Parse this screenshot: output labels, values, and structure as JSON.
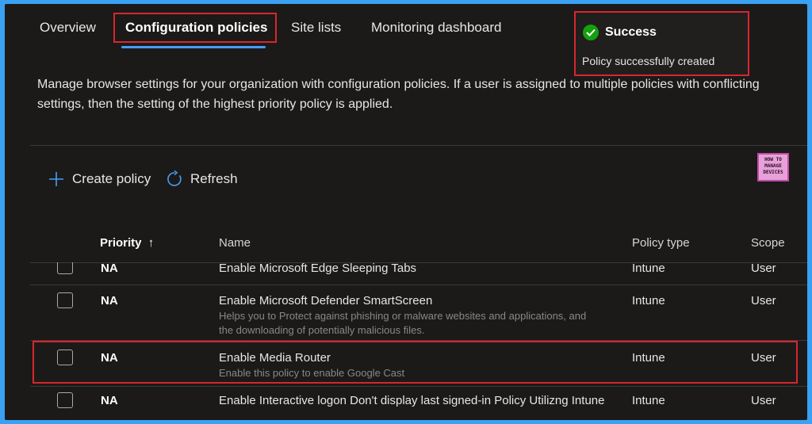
{
  "tabs": [
    {
      "label": "Overview"
    },
    {
      "label": "Configuration policies"
    },
    {
      "label": "Site lists"
    },
    {
      "label": "Monitoring dashboard"
    }
  ],
  "toast": {
    "title": "Success",
    "message": "Policy successfully created",
    "status_color": "#13a10e"
  },
  "description": "Manage browser settings for your organization with configuration policies. If a user is assigned to multiple policies with conflicting settings, then the setting of the highest priority policy is applied.",
  "toolbar": {
    "create_label": "Create policy",
    "refresh_label": "Refresh"
  },
  "logo": {
    "line1": "HOW TO",
    "line2": "MANAGE",
    "line3": "DEVICES"
  },
  "table": {
    "columns": {
      "priority": "Priority",
      "priority_sort_icon": "↑",
      "name": "Name",
      "policy_type": "Policy type",
      "scope": "Scope"
    },
    "rows": [
      {
        "priority": "NA",
        "name": "Enable Microsoft Edge Sleeping Tabs",
        "desc1": "",
        "desc2": "",
        "policy_type": "Intune",
        "scope": "User"
      },
      {
        "priority": "NA",
        "name": "Enable Microsoft Defender SmartScreen",
        "desc1": "Helps you to Protect against phishing or malware websites and applications, and",
        "desc2": "the downloading of potentially malicious files.",
        "policy_type": "Intune",
        "scope": "User"
      },
      {
        "priority": "NA",
        "name": "Enable Media Router",
        "desc1": "Enable this policy to enable Google Cast",
        "desc2": "",
        "policy_type": "Intune",
        "scope": "User"
      },
      {
        "priority": "NA",
        "name": "Enable Interactive logon Don't display last signed-in Policy Utilizng Intune",
        "desc1": "",
        "desc2": "",
        "policy_type": "Intune",
        "scope": "User"
      }
    ]
  },
  "colors": {
    "accent": "#479ef5",
    "highlight": "#d9262c",
    "background": "#1b1a19",
    "frame_border": "#3aa0f2"
  }
}
